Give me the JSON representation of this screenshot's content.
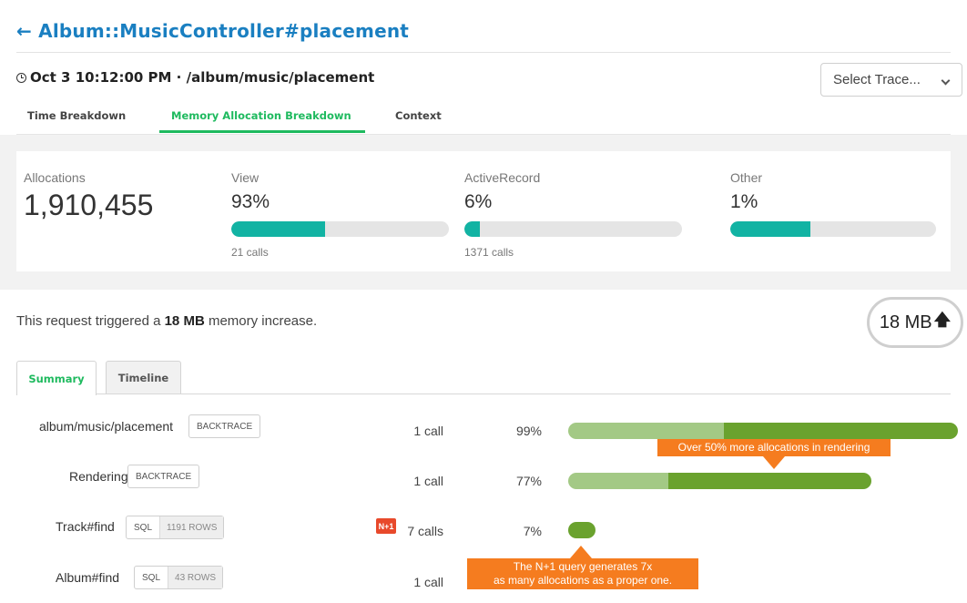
{
  "header": {
    "back_arrow": "←",
    "title": "Album::MusicController#placement",
    "subtitle": "Oct 3 10:12:00 PM · /album/music/placement",
    "clock_icon": "clock-icon",
    "trace_select": "Select Trace..."
  },
  "tabs": [
    {
      "label": "Time Breakdown",
      "active": false
    },
    {
      "label": "Memory Allocation Breakdown",
      "active": true
    },
    {
      "label": "Context",
      "active": false
    }
  ],
  "stats": {
    "allocations_label": "Allocations",
    "allocations_value": "1,910,455",
    "groups": [
      {
        "label": "View",
        "percent": "93%",
        "bar_fill_fraction": 0.43,
        "calls": "21 calls"
      },
      {
        "label": "ActiveRecord",
        "percent": "6%",
        "bar_fill_fraction": 0.07,
        "calls": "1371 calls"
      },
      {
        "label": "Other",
        "percent": "1%",
        "bar_fill_fraction": 0.39,
        "calls": ""
      }
    ]
  },
  "memory": {
    "text_before": "This request triggered a ",
    "text_bold": "18 MB",
    "text_after": " memory increase.",
    "badge_value": "18 MB",
    "badge_icon": "arrow-up-icon"
  },
  "subtabs": [
    {
      "label": "Summary",
      "active": true
    },
    {
      "label": "Timeline",
      "active": false
    }
  ],
  "rows": [
    {
      "name": "album/music/placement",
      "tag": "BACKTRACE",
      "rows_label": "",
      "calls": "1 call",
      "percent": "99%",
      "share": 0.99,
      "dark_share": 0.6,
      "n_plus_one": false
    },
    {
      "name": "Rendering",
      "tag": "BACKTRACE",
      "rows_label": "",
      "calls": "1 call",
      "percent": "77%",
      "share": 0.77,
      "dark_share": 0.67,
      "n_plus_one": false
    },
    {
      "name": "Track#find",
      "tag": "SQL",
      "rows_label": "1191 ROWS",
      "calls": "7 calls",
      "percent": "7%",
      "share": 0.07,
      "dark_share": 0.6,
      "n_plus_one": true
    },
    {
      "name": "Album#find",
      "tag": "SQL",
      "rows_label": "43 ROWS",
      "calls": "1 call",
      "percent": "",
      "share": 0,
      "dark_share": 0,
      "n_plus_one": false
    }
  ],
  "n_plus_one_label": "N+1",
  "callouts": {
    "rendering": "Over 50% more allocations in rendering",
    "n_plus_one_line1": "The N+1 query generates 7x",
    "n_plus_one_line2": "as many allocations as a proper one."
  },
  "colors": {
    "title": "#1a7fc1",
    "active_tab": "#1fba5f",
    "stat_bar": "#12b3a3",
    "bar_light": "#a3c985",
    "bar_dark": "#6aa22e",
    "callout": "#f57c1f",
    "n_plus_one": "#e8492b"
  }
}
